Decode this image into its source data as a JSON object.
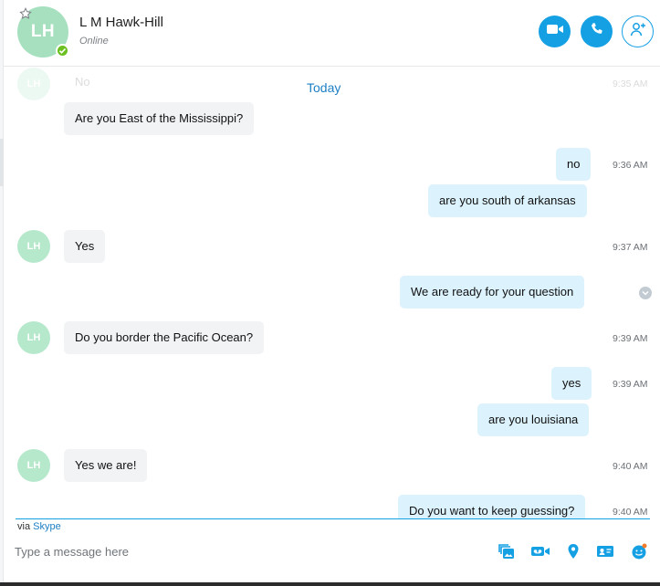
{
  "contact": {
    "initials": "LH",
    "name": "L M Hawk-Hill",
    "status": "Online"
  },
  "header_actions": {
    "video_call_icon": "video-camera-icon",
    "audio_call_icon": "phone-icon",
    "add_people_icon": "add-person-icon"
  },
  "conversation": {
    "date_divider": "Today",
    "messages": [
      {
        "dir": "in",
        "text": "No",
        "time": "9:35 AM",
        "show_avatar": true
      },
      {
        "dir": "in",
        "text": "Are you East of the Mississippi?",
        "time": "",
        "show_avatar": false
      },
      {
        "dir": "out",
        "text": "no",
        "time": "9:36 AM"
      },
      {
        "dir": "out",
        "text": "are you south of arkansas",
        "time": ""
      },
      {
        "dir": "in",
        "text": "Yes",
        "time": "9:37 AM",
        "show_avatar": true
      },
      {
        "dir": "out",
        "text": "We are ready for your question",
        "time": "",
        "status_icon": "chevron-down-icon"
      },
      {
        "dir": "in",
        "text": "Do you border the Pacific Ocean?",
        "time": "9:39 AM",
        "show_avatar": true
      },
      {
        "dir": "out",
        "text": "yes",
        "time": "9:39 AM"
      },
      {
        "dir": "out",
        "text": "are you louisiana",
        "time": ""
      },
      {
        "dir": "in",
        "text": "Yes we are!",
        "time": "9:40 AM",
        "show_avatar": true
      },
      {
        "dir": "out",
        "text": "Do you want to keep guessing?",
        "time": "9:40 AM"
      }
    ]
  },
  "composer": {
    "via_prefix": "via",
    "via_link": "Skype",
    "placeholder": "Type a message here",
    "tools": [
      "image-icon",
      "voicemail-icon",
      "location-pin-icon",
      "contact-card-icon",
      "emoji-icon"
    ]
  },
  "colors": {
    "accent": "#16a0e4",
    "link": "#1e7fc4",
    "avatar": "#a6e0bf",
    "online": "#6bbf1f",
    "incoming_bubble": "#f2f3f5",
    "outgoing_bubble": "#dcf2fd"
  }
}
